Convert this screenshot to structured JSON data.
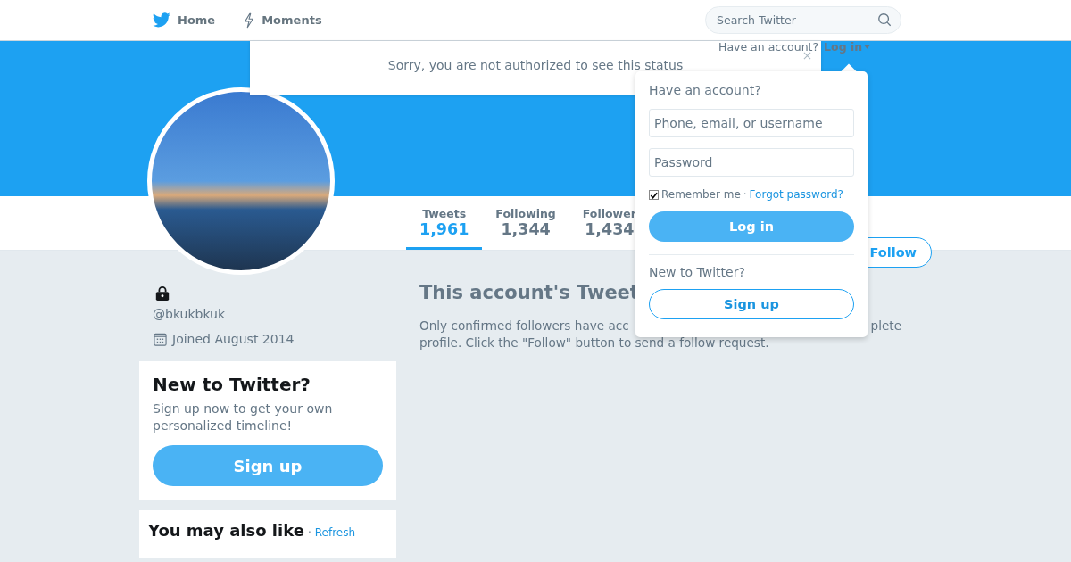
{
  "header": {
    "nav": [
      {
        "kind": "bird",
        "label": "Home"
      },
      {
        "kind": "bolt",
        "label": "Moments"
      }
    ],
    "search": {
      "placeholder": "Search Twitter"
    }
  },
  "account_prompt": {
    "text": "Have an account?",
    "link": "Log in"
  },
  "notification": {
    "text": "Sorry, you are not authorized to see this status"
  },
  "login_dropdown": {
    "title": "Have an account?",
    "username_placeholder": "Phone, email, or username",
    "password_placeholder": "Password",
    "remember": {
      "label": "Remember me",
      "checked": true
    },
    "separator": "·",
    "forgot": "Forgot password?",
    "login_button": "Log in",
    "new_title": "New to Twitter?",
    "signup_button": "Sign up"
  },
  "stats": [
    {
      "label": "Tweets",
      "value": "1,961",
      "selected": true
    },
    {
      "label": "Following",
      "value": "1,344",
      "selected": false
    },
    {
      "label": "Follower",
      "value": "1,434",
      "selected": false
    }
  ],
  "follow_button": "Follow",
  "profile": {
    "handle": "@bkukbkuk",
    "joined": "Joined August 2014"
  },
  "protected_notice": {
    "title": "This account's Tweet",
    "line_1_start": "Only confirmed followers have acc",
    "line_1_end": "plete",
    "line_2": "profile. Click the \"Follow\" button to send a follow request."
  },
  "signup_card": {
    "title": "New to Twitter?",
    "text": "Sign up now to get your own personalized timeline!",
    "button": "Sign up"
  },
  "suggestions": {
    "title": "You may also like",
    "separator": "·",
    "refresh": "Refresh"
  }
}
